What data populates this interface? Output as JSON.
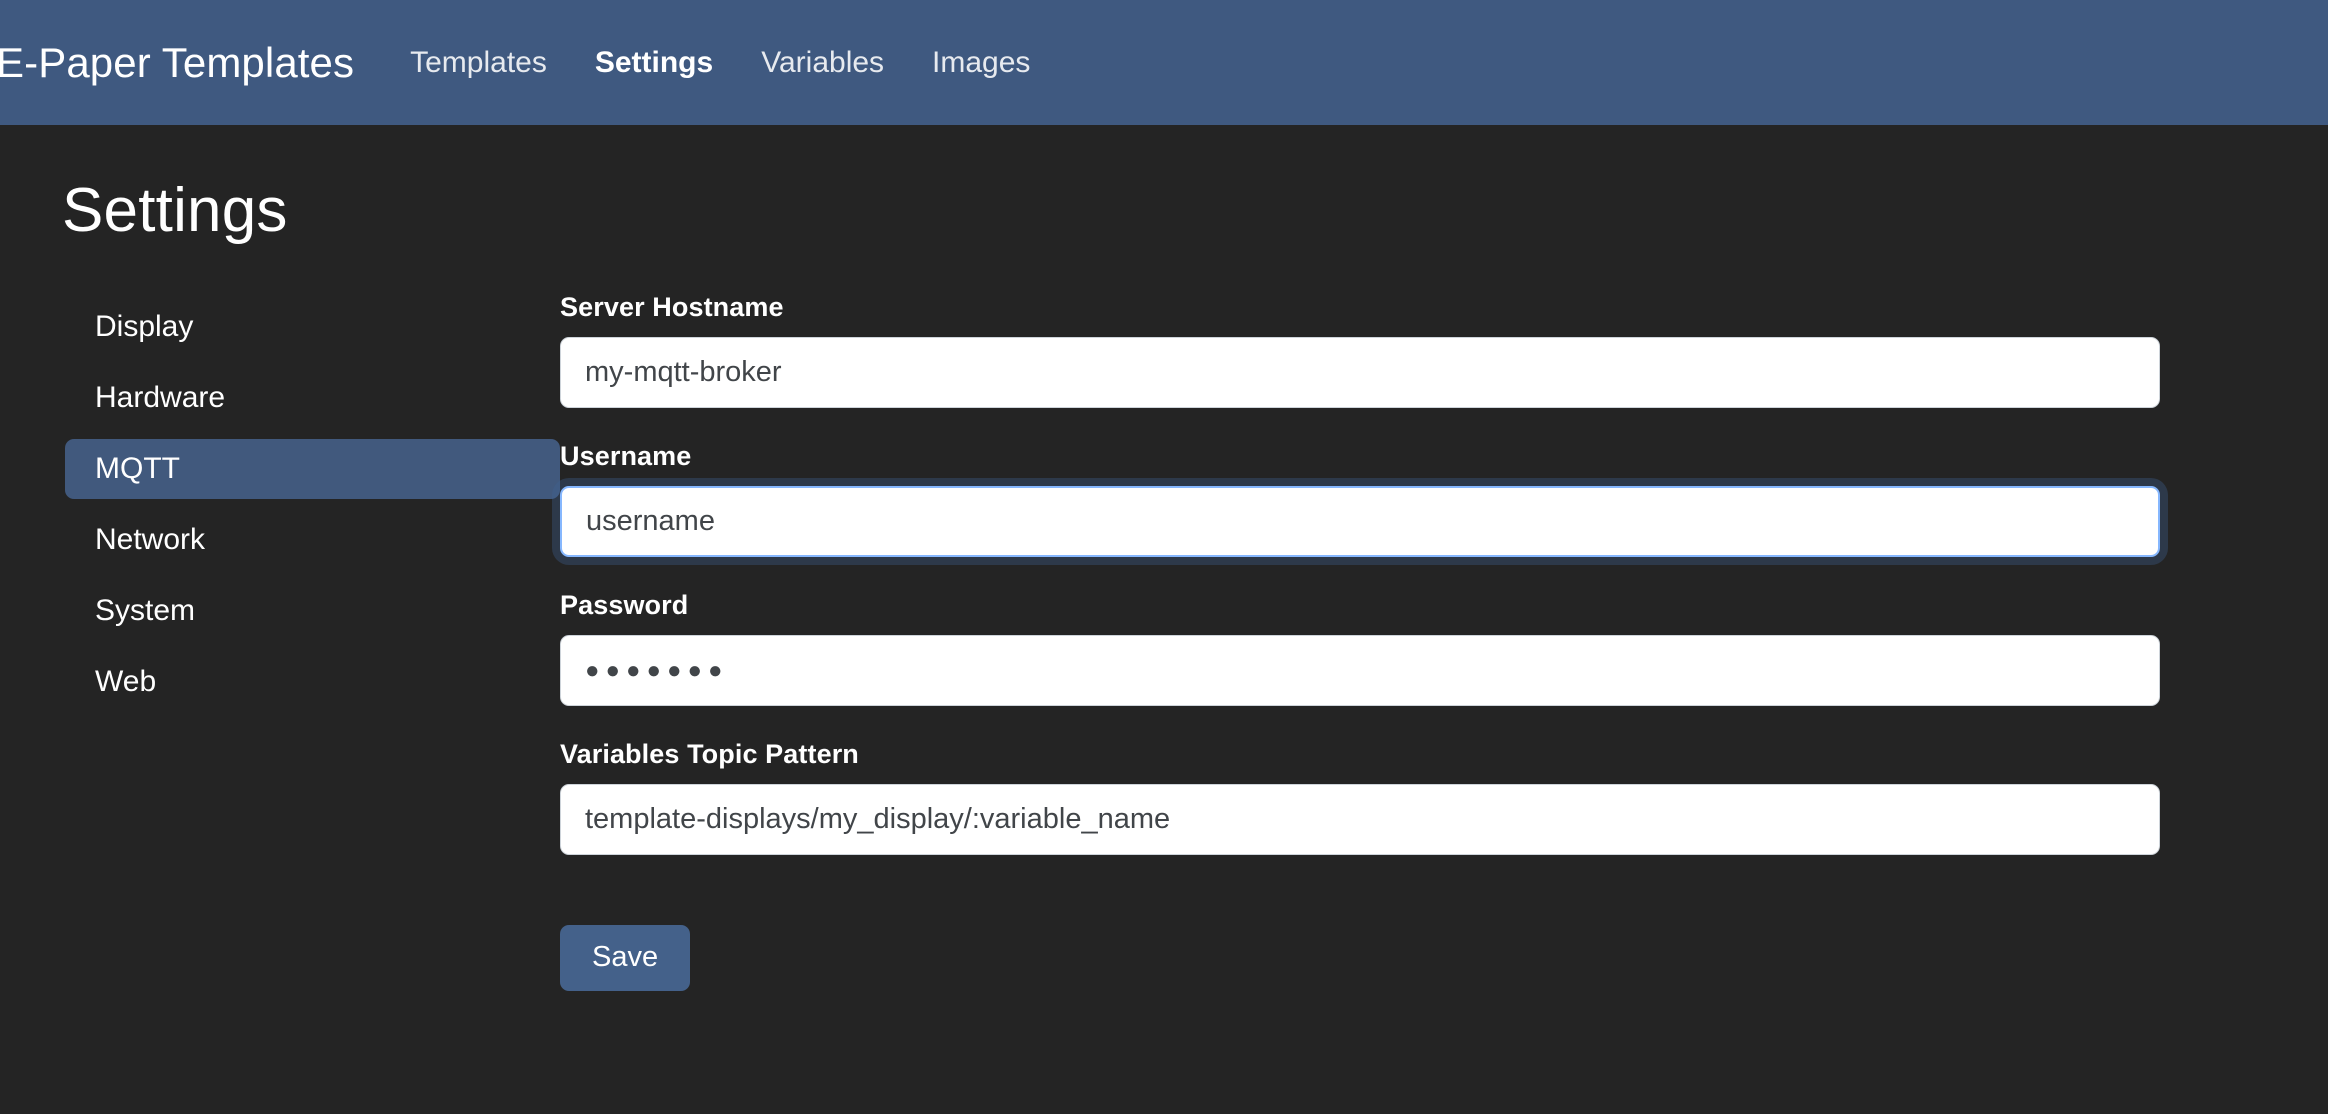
{
  "navbar": {
    "brand": "E-Paper Templates",
    "links": [
      {
        "label": "Templates",
        "active": false
      },
      {
        "label": "Settings",
        "active": true
      },
      {
        "label": "Variables",
        "active": false
      },
      {
        "label": "Images",
        "active": false
      }
    ],
    "background_color": "#3f5980"
  },
  "page": {
    "title": "Settings",
    "background_color": "#242424"
  },
  "sidebar": {
    "items": [
      {
        "label": "Display",
        "active": false
      },
      {
        "label": "Hardware",
        "active": false
      },
      {
        "label": "MQTT",
        "active": true
      },
      {
        "label": "Network",
        "active": false
      },
      {
        "label": "System",
        "active": false
      },
      {
        "label": "Web",
        "active": false
      }
    ],
    "active_color": "#41597d"
  },
  "form": {
    "fields": [
      {
        "label": "Server Hostname",
        "value": "my-mqtt-broker",
        "placeholder": "my-mqtt-broker",
        "type": "text",
        "focused": false
      },
      {
        "label": "Username",
        "value": "username",
        "placeholder": "username",
        "type": "text",
        "focused": true
      },
      {
        "label": "Password",
        "value": "●●●●●●●",
        "placeholder": "",
        "type": "password",
        "focused": false
      },
      {
        "label": "Variables Topic Pattern",
        "value": "template-displays/my_display/:variable_name",
        "placeholder": "template-displays/my_display/:variable_name",
        "type": "text",
        "focused": false
      }
    ],
    "save_label": "Save",
    "save_color": "#44618a"
  }
}
